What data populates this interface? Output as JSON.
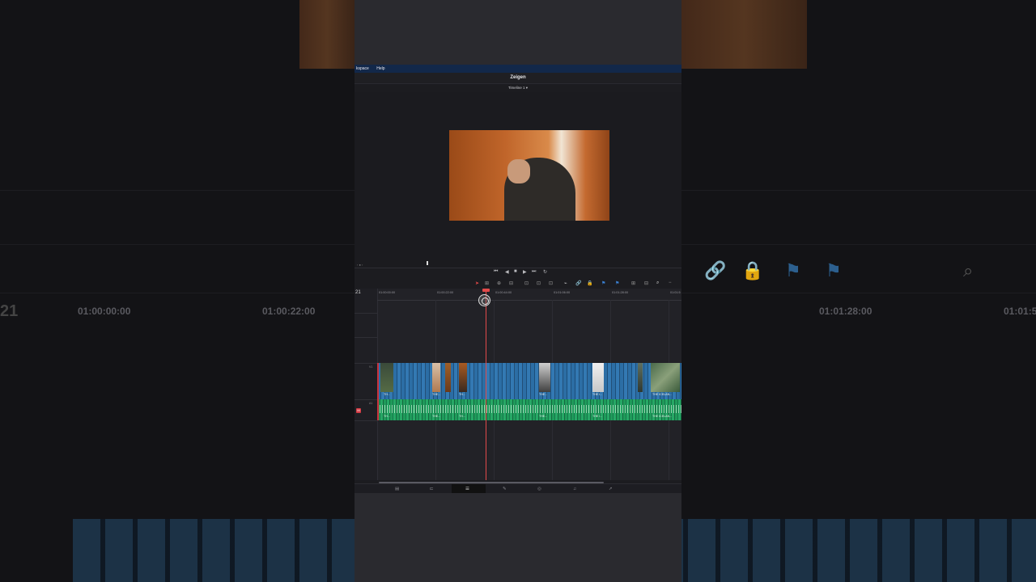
{
  "menu": {
    "items": [
      "kspace",
      "Help"
    ]
  },
  "app": {
    "project_title": "Zeigen",
    "timeline_name": "Timeline 1",
    "timeline_chevron": "▾"
  },
  "timeline": {
    "current_timecode": "21",
    "ruler_ticks": [
      "01:00:00:00",
      "01:00:22:00",
      "01:00:44:00",
      "01:01:06:00",
      "01:01:28:00",
      "01:01:5"
    ],
    "track_labels": [
      "V1",
      "A1"
    ],
    "mute_badge": "M",
    "video_clip_labels": [
      "TH...",
      "THE...",
      "TH...",
      "THE...",
      "THE I...",
      "THE ICELAN..."
    ],
    "audio_clip_labels": [
      "TH...",
      "THE...",
      "TH...",
      "THE...",
      "THE I...",
      "THE ICELAN..."
    ]
  },
  "background": {
    "timecodes": [
      "01:00:00:00",
      "01:00:22:00",
      "01:01:28:00",
      "01:01:5"
    ],
    "left_number": "21"
  },
  "colors": {
    "menu_bar": "#12284a",
    "video_track": "#2c6ea5",
    "audio_track": "#1f9a5a",
    "playhead": "#e24a4a"
  },
  "icons": {
    "transport": [
      "skip-back-icon",
      "play-reverse-icon",
      "stop-icon",
      "play-icon",
      "skip-forward-icon",
      "loop-icon"
    ],
    "pages": [
      "media-page-icon",
      "cut-page-icon",
      "edit-page-icon",
      "fusion-page-icon",
      "color-page-icon",
      "fairlight-page-icon",
      "deliver-page-icon"
    ]
  }
}
